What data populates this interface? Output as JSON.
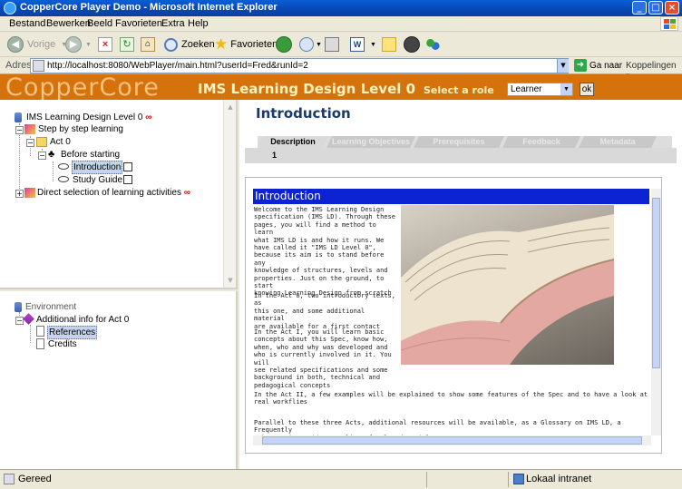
{
  "window": {
    "title": "CopperCore Player Demo - Microsoft Internet Explorer"
  },
  "menubar": {
    "items": [
      "Bestand",
      "Bewerken",
      "Beeld",
      "Favorieten",
      "Extra",
      "Help"
    ]
  },
  "toolbar": {
    "back_label": "Vorige",
    "search_label": "Zoeken",
    "favorites_label": "Favorieten"
  },
  "address": {
    "label": "Adres",
    "url": "http://localhost:8080/WebPlayer/main.html?userId=Fred&runId=2",
    "go_label": "Ga naar",
    "links_label": "Koppelingen"
  },
  "banner": {
    "logo": "CopperCore",
    "title": "IMS Learning Design Level 0",
    "role_label": "Select a role",
    "role_value": "Learner",
    "ok_label": "ok"
  },
  "activity_tree": {
    "root": "IMS Learning Design Level 0",
    "step": "Step by step learning",
    "act": "Act 0",
    "before": "Before starting",
    "introduction": "Introduction",
    "study_guide": "Study Guide",
    "direct": "Direct selection of learning activities"
  },
  "environment_tree": {
    "root": "Environment",
    "additional": "Additional info for Act 0",
    "references": "References",
    "credits": "Credits"
  },
  "content": {
    "page_title": "Introduction",
    "tabs": [
      "Description",
      "Learning Objectives",
      "Prerequisites",
      "Feedback",
      "Metadata"
    ],
    "active_tab": 0,
    "tab_body_value": "1",
    "frame_heading": "Introduction",
    "para1": [
      "Welcome to the IMS Learning Design",
      "specification (IMS LD). Through these",
      "pages, you will find a method to learn",
      "what IMS LD is and how it runs. We",
      "have called it \"IMS LD Level 0\",",
      "because its aim is to stand before any",
      "knowledge of structures, levels and",
      "properties. Just on the ground, to start",
      "knowing Learning Design from scratch"
    ],
    "para2": [
      "In the Act 0, two introductory texts, as",
      "this one, and some additional material",
      "are available for a first contact"
    ],
    "para3": [
      "In the Act I, you will learn basic",
      "concepts about this Spec, know how,",
      "when, who and why was developed and",
      "who is currently involved in it. You will",
      "see related specifications and some",
      "background in both, technical and",
      "pedagogical concepts"
    ],
    "para4": [
      "In the Act II, a few examples will be explained to show some features of the Spec and to have a look at",
      "real workflies"
    ],
    "para5": [
      "Parallel to these three Acts, additional resources will be available, as a Glossary on IMS LD, a Frequently",
      "Ask Question Guide or a list of related Articles"
    ]
  },
  "statusbar": {
    "status": "Gereed",
    "zone": "Lokaal intranet"
  },
  "colors": {
    "banner_bg": "#d5720b",
    "title_blue": "#0b23d3",
    "heading_navy": "#1a3a6b"
  }
}
